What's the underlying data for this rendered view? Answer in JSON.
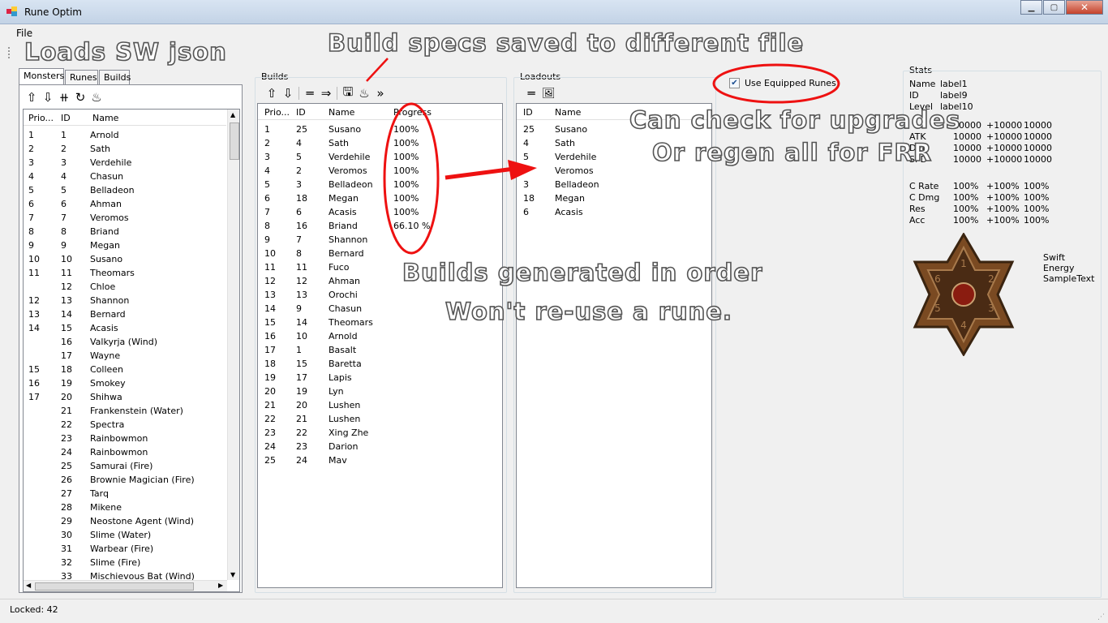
{
  "window": {
    "title": "Rune Optim",
    "minimize": "▁",
    "maximize": "▢",
    "close": "✕"
  },
  "menu": {
    "file": "File"
  },
  "annotations": {
    "loads": "Loads SW json",
    "build_specs": "Build specs saved to different file",
    "check_upgrades": "Can check for upgrades",
    "regen": "Or regen all for FRR",
    "builds_order": "Builds generated in order",
    "no_reuse": "Won't re-use a rune."
  },
  "tabs": [
    "Monsters",
    "Runes",
    "Builds"
  ],
  "monsters": {
    "headers": [
      "Prio...",
      "ID",
      "Name"
    ],
    "rows": [
      [
        "1",
        "1",
        "Arnold"
      ],
      [
        "2",
        "2",
        "Sath"
      ],
      [
        "3",
        "3",
        "Verdehile"
      ],
      [
        "4",
        "4",
        "Chasun"
      ],
      [
        "5",
        "5",
        "Belladeon"
      ],
      [
        "6",
        "6",
        "Ahman"
      ],
      [
        "7",
        "7",
        "Veromos"
      ],
      [
        "8",
        "8",
        "Briand"
      ],
      [
        "9",
        "9",
        "Megan"
      ],
      [
        "10",
        "10",
        "Susano"
      ],
      [
        "11",
        "11",
        "Theomars"
      ],
      [
        "",
        "12",
        "Chloe"
      ],
      [
        "12",
        "13",
        "Shannon"
      ],
      [
        "13",
        "14",
        "Bernard"
      ],
      [
        "14",
        "15",
        "Acasis"
      ],
      [
        "",
        "16",
        "Valkyrja (Wind)"
      ],
      [
        "",
        "17",
        "Wayne"
      ],
      [
        "15",
        "18",
        "Colleen"
      ],
      [
        "16",
        "19",
        "Smokey"
      ],
      [
        "17",
        "20",
        "Shihwa"
      ],
      [
        "",
        "21",
        "Frankenstein (Water)"
      ],
      [
        "",
        "22",
        "Spectra"
      ],
      [
        "",
        "23",
        "Rainbowmon"
      ],
      [
        "",
        "24",
        "Rainbowmon"
      ],
      [
        "",
        "25",
        "Samurai (Fire)"
      ],
      [
        "",
        "26",
        "Brownie Magician (Fire)"
      ],
      [
        "",
        "27",
        "Tarq"
      ],
      [
        "",
        "28",
        "Mikene"
      ],
      [
        "",
        "29",
        "Neostone Agent (Wind)"
      ],
      [
        "",
        "30",
        "Slime (Water)"
      ],
      [
        "",
        "31",
        "Warbear (Fire)"
      ],
      [
        "",
        "32",
        "Slime (Fire)"
      ],
      [
        "",
        "33",
        "Mischievous Bat (Wind)"
      ]
    ]
  },
  "builds": {
    "label": "Builds",
    "headers": [
      "Prio...",
      "ID",
      "Name",
      "Progress"
    ],
    "rows": [
      [
        "1",
        "25",
        "Susano",
        "100%"
      ],
      [
        "2",
        "4",
        "Sath",
        "100%"
      ],
      [
        "3",
        "5",
        "Verdehile",
        "100%"
      ],
      [
        "4",
        "2",
        "Veromos",
        "100%"
      ],
      [
        "5",
        "3",
        "Belladeon",
        "100%"
      ],
      [
        "6",
        "18",
        "Megan",
        "100%"
      ],
      [
        "7",
        "6",
        "Acasis",
        "100%"
      ],
      [
        "8",
        "16",
        "Briand",
        "66.10 %"
      ],
      [
        "9",
        "7",
        "Shannon",
        ""
      ],
      [
        "10",
        "8",
        "Bernard",
        ""
      ],
      [
        "11",
        "11",
        "Fuco",
        ""
      ],
      [
        "12",
        "12",
        "Ahman",
        ""
      ],
      [
        "13",
        "13",
        "Orochi",
        ""
      ],
      [
        "14",
        "9",
        "Chasun",
        ""
      ],
      [
        "15",
        "14",
        "Theomars",
        ""
      ],
      [
        "16",
        "10",
        "Arnold",
        ""
      ],
      [
        "17",
        "1",
        "Basalt",
        ""
      ],
      [
        "18",
        "15",
        "Baretta",
        ""
      ],
      [
        "19",
        "17",
        "Lapis",
        ""
      ],
      [
        "20",
        "19",
        "Lyn",
        ""
      ],
      [
        "21",
        "20",
        "Lushen",
        ""
      ],
      [
        "22",
        "21",
        "Lushen",
        ""
      ],
      [
        "23",
        "22",
        "Xing Zhe",
        ""
      ],
      [
        "24",
        "23",
        "Darion",
        ""
      ],
      [
        "25",
        "24",
        "Mav",
        ""
      ]
    ]
  },
  "loadouts": {
    "label": "Loadouts",
    "headers": [
      "ID",
      "Name"
    ],
    "rows": [
      [
        "25",
        "Susano"
      ],
      [
        "4",
        "Sath"
      ],
      [
        "5",
        "Verdehile"
      ],
      [
        "",
        "Veromos"
      ],
      [
        "3",
        "Belladeon"
      ],
      [
        "18",
        "Megan"
      ],
      [
        "6",
        "Acasis"
      ]
    ]
  },
  "use_equipped": {
    "label": "Use Equipped Runes",
    "checked": true
  },
  "stats": {
    "label": "Stats",
    "info": [
      [
        "Name",
        "label1"
      ],
      [
        "ID",
        "label9"
      ],
      [
        "Level",
        "label10"
      ]
    ],
    "main": [
      [
        "",
        "10000",
        "+10000",
        "10000"
      ],
      [
        "ATK",
        "10000",
        "+10000",
        "10000"
      ],
      [
        "DEF",
        "10000",
        "+10000",
        "10000"
      ],
      [
        "SPD",
        "10000",
        "+10000",
        "10000"
      ]
    ],
    "secondary": [
      [
        "C Rate",
        "100%",
        "+100%",
        "100%"
      ],
      [
        "C Dmg",
        "100%",
        "+100%",
        "100%"
      ],
      [
        "Res",
        "100%",
        "+100%",
        "100%"
      ],
      [
        "Acc",
        "100%",
        "+100%",
        "100%"
      ]
    ],
    "rune_slots": [
      "1",
      "2",
      "3",
      "4",
      "5",
      "6"
    ],
    "set_info": [
      "Swift",
      "Energy",
      "SampleText"
    ]
  },
  "status": {
    "locked": "Locked: 42"
  },
  "icons": {
    "monsters_toolbar": [
      "⇧",
      "⇩",
      "⧺",
      "↻",
      "♨"
    ],
    "builds_toolbar": [
      "⇧",
      "⇩",
      "═",
      "⇒",
      "🖫",
      "♨",
      "»"
    ],
    "loadouts_toolbar": [
      "═",
      "🖼"
    ]
  },
  "colors": {
    "annotation_red": "#ee1111",
    "accent": "#3399ff"
  }
}
